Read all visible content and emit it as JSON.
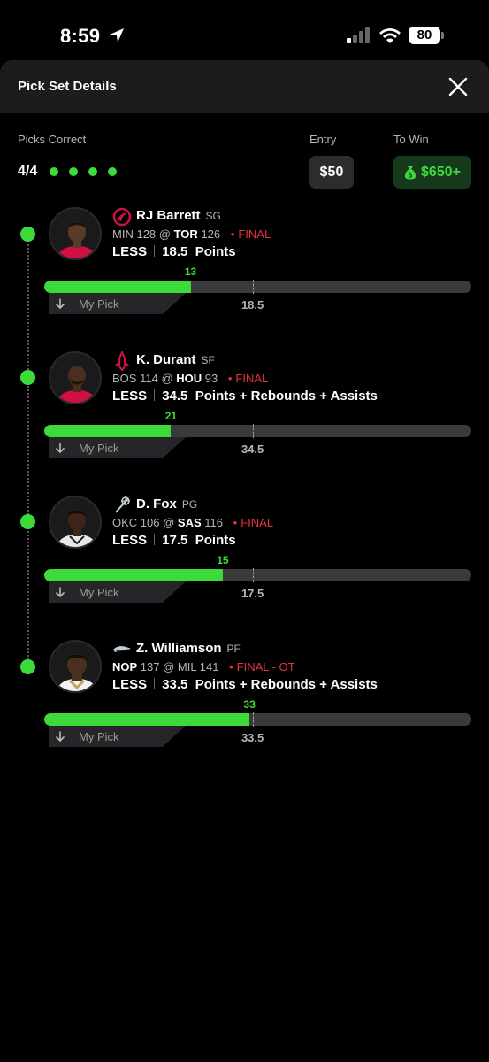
{
  "status_bar": {
    "time": "8:59",
    "battery": "80",
    "icons": [
      "location-arrow-icon",
      "cellular-signal-icon",
      "wifi-icon",
      "battery-icon"
    ]
  },
  "header": {
    "title": "Pick Set Details",
    "close_icon": "close-icon"
  },
  "summary": {
    "picks_correct_label": "Picks Correct",
    "picks_correct_value": "4/4",
    "correct_dots": 4,
    "entry_label": "Entry",
    "entry_value": "$50",
    "to_win_label": "To Win",
    "to_win_value": "$650+",
    "to_win_icon": "money-bag-icon"
  },
  "colors": {
    "accent": "#3ddb3a",
    "final": "#e5333f",
    "background": "#000000"
  },
  "my_pick_label": "My Pick",
  "picks": [
    {
      "name": "RJ Barrett",
      "position": "SG",
      "team_icon": "raptors-logo-icon",
      "away_team": "MIN",
      "away_score": "128",
      "home_team": "TOR",
      "home_score": "126",
      "bold_team": "home",
      "status": "FINAL",
      "direction": "LESS",
      "line": "18.5",
      "stat": "Points",
      "actual": "13",
      "actual_value": 13,
      "line_value": 18.5
    },
    {
      "name": "K. Durant",
      "position": "SF",
      "team_icon": "rockets-logo-icon",
      "away_team": "BOS",
      "away_score": "114",
      "home_team": "HOU",
      "home_score": "93",
      "bold_team": "home",
      "status": "FINAL",
      "direction": "LESS",
      "line": "34.5",
      "stat": "Points + Rebounds + Assists",
      "actual": "21",
      "actual_value": 21,
      "line_value": 34.5
    },
    {
      "name": "D. Fox",
      "position": "PG",
      "team_icon": "spurs-logo-icon",
      "away_team": "OKC",
      "away_score": "106",
      "home_team": "SAS",
      "home_score": "116",
      "bold_team": "home",
      "status": "FINAL",
      "direction": "LESS",
      "line": "17.5",
      "stat": "Points",
      "actual": "15",
      "actual_value": 15,
      "line_value": 17.5
    },
    {
      "name": "Z. Williamson",
      "position": "PF",
      "team_icon": "pelicans-logo-icon",
      "away_team": "NOP",
      "away_score": "137",
      "home_team": "MIL",
      "home_score": "141",
      "bold_team": "away",
      "status": "FINAL - OT",
      "direction": "LESS",
      "line": "33.5",
      "stat": "Points + Rebounds + Assists",
      "actual": "33",
      "actual_value": 33,
      "line_value": 33.5
    }
  ]
}
